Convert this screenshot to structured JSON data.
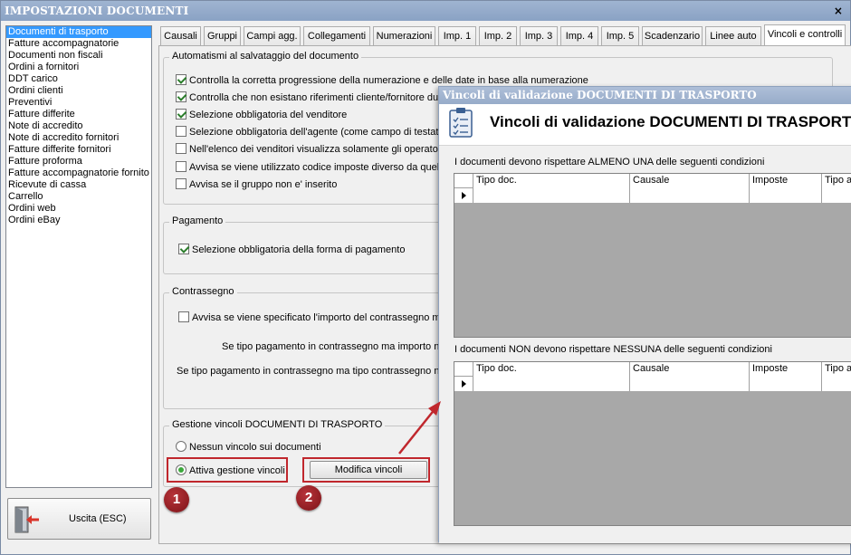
{
  "window": {
    "title": "IMPOSTAZIONI DOCUMENTI",
    "close": "×"
  },
  "left_list": {
    "items": [
      "Documenti di trasporto",
      "Fatture accompagnatorie",
      "Documenti non fiscali",
      "Ordini a fornitori",
      "DDT carico",
      "Ordini clienti",
      "Preventivi",
      "Fatture differite",
      "Note di accredito",
      "Note di accredito fornitori",
      "Fatture differite fornitori",
      "Fatture proforma",
      "Fatture accompagnatorie fornito",
      "Ricevute di cassa",
      "Carrello",
      "Ordini web",
      "Ordini eBay"
    ],
    "selected": "Documenti di trasporto"
  },
  "exit_button": {
    "label": "Uscita (ESC)"
  },
  "tabs": {
    "items": [
      "Causali",
      "Gruppi",
      "Campi agg.",
      "Collegamenti",
      "Numerazioni",
      "Imp. 1",
      "Imp. 2",
      "Imp. 3",
      "Imp. 4",
      "Imp. 5",
      "Scadenzario",
      "Linee auto",
      "Vincoli e controlli"
    ],
    "active": "Vincoli e controlli"
  },
  "automatismi": {
    "legend": "Automatismi al salvataggio del documento",
    "options": [
      {
        "label": "Controlla la corretta progressione della numerazione e delle date in base alla numerazione",
        "checked": true
      },
      {
        "label": "Controlla che non esistano riferimenti cliente/fornitore dup",
        "checked": true
      },
      {
        "label": "Selezione obbligatoria del venditore",
        "checked": true
      },
      {
        "label": "Selezione obbligatoria dell'agente (come campo di testata)",
        "checked": false
      },
      {
        "label": "Nell'elenco dei venditori visualizza solamente gli operatori",
        "checked": false
      },
      {
        "label": "Avvisa se viene utilizzato codice imposte diverso da quello",
        "checked": false
      },
      {
        "label": "Avvisa se il gruppo non e' inserito",
        "checked": false
      }
    ]
  },
  "pagamento": {
    "legend": "Pagamento",
    "option": {
      "label": "Selezione obbligatoria della forma di pagamento",
      "checked": true
    }
  },
  "contrassegno": {
    "legend": "Contrassegno",
    "option": {
      "label": "Avvisa se viene specificato l'importo del contrassegno ma",
      "checked": false
    },
    "line1": "Se tipo pagamento in contrassegno ma importo no",
    "line2": "Se tipo pagamento in contrassegno ma tipo contrassegno no"
  },
  "vincoli": {
    "legend": "Gestione vincoli DOCUMENTI DI TRASPORTO",
    "radio_none": "Nessun vincolo sui documenti",
    "radio_active": "Attiva gestione vincoli",
    "selected": "Attiva gestione vincoli",
    "modify_button": "Modifica vincoli"
  },
  "badges": {
    "one": "1",
    "two": "2"
  },
  "dialog": {
    "title": "Vincoli di validazione DOCUMENTI DI TRASPORTO",
    "header_title": "Vincoli di validazione DOCUMENTI DI TRASPORTO",
    "grid1": {
      "caption": "I documenti devono rispettare ALMENO UNA delle seguenti condizioni",
      "columns": [
        "Tipo doc.",
        "Causale",
        "Imposte",
        "Tipo ar"
      ]
    },
    "grid2": {
      "caption": "I documenti NON devono rispettare NESSUNA delle seguenti condizioni",
      "columns": [
        "Tipo doc.",
        "Causale",
        "Imposte",
        "Tipo ar"
      ]
    }
  },
  "colors": {
    "accent_red": "#c0272d",
    "selection_blue": "#3399ff",
    "title_blue": "#8aa2c4"
  }
}
